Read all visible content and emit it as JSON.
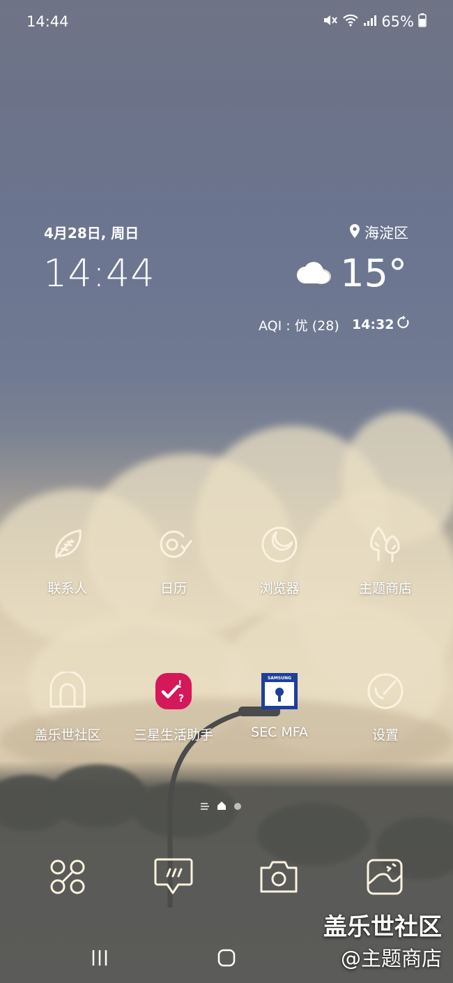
{
  "status_bar": {
    "time": "14:44",
    "battery": "65%"
  },
  "widget": {
    "date": "4月28日, 周日",
    "time": "14:44",
    "location": "海淀区",
    "temperature": "15°",
    "aqi": "AQI : 优 (28)",
    "updated": "14:32"
  },
  "apps": [
    {
      "label": "联系人",
      "icon": "leaf-icon"
    },
    {
      "label": "日历",
      "icon": "at-check-icon"
    },
    {
      "label": "浏览器",
      "icon": "moon-circle-icon"
    },
    {
      "label": "主题商店",
      "icon": "trees-icon"
    },
    {
      "label": "盖乐世社区",
      "icon": "arch-icon"
    },
    {
      "label": "三星生活助手",
      "icon": "check-question-icon"
    },
    {
      "label": "SEC MFA",
      "icon": "samsung-lock-icon",
      "brand": "SAMSUNG"
    },
    {
      "label": "设置",
      "icon": "gear-circle-icon"
    }
  ],
  "dock": [
    {
      "icon": "nodes-icon"
    },
    {
      "icon": "message-icon"
    },
    {
      "icon": "camera-icon"
    },
    {
      "icon": "gallery-icon"
    }
  ],
  "colors": {
    "life_assistant": "#d4185a",
    "sec_mfa": "#1c3f9a",
    "icon_stroke": "#fbf3df"
  },
  "watermark": {
    "line1": "盖乐世社区",
    "line2": "@主题商店"
  }
}
